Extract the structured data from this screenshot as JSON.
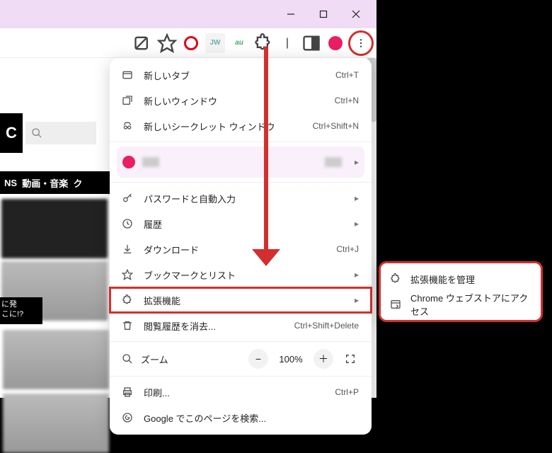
{
  "window": {
    "min": "−",
    "max": "□",
    "close": "×"
  },
  "nav": {
    "ns": "NS",
    "video": "動画・音楽",
    "gmore": "ク"
  },
  "caption": {
    "l1": "に発",
    "l2": "こに!?"
  },
  "menu": {
    "new_tab": {
      "label": "新しいタブ",
      "shortcut": "Ctrl+T"
    },
    "new_window": {
      "label": "新しいウィンドウ",
      "shortcut": "Ctrl+N"
    },
    "new_incognito": {
      "label": "新しいシークレット ウィンドウ",
      "shortcut": "Ctrl+Shift+N"
    },
    "passwords": {
      "label": "パスワードと自動入力"
    },
    "history": {
      "label": "履歴"
    },
    "downloads": {
      "label": "ダウンロード",
      "shortcut": "Ctrl+J"
    },
    "bookmarks": {
      "label": "ブックマークとリスト"
    },
    "extensions": {
      "label": "拡張機能"
    },
    "clear_browsing": {
      "label": "閲覧履歴を消去...",
      "shortcut": "Ctrl+Shift+Delete"
    },
    "zoom": {
      "label": "ズーム",
      "value": "100%",
      "minus": "−",
      "plus": "＋"
    },
    "print": {
      "label": "印刷...",
      "shortcut": "Ctrl+P"
    },
    "search": {
      "label": "Google でこのページを検索..."
    }
  },
  "submenu": {
    "manage": "拡張機能を管理",
    "webstore": "Chrome ウェブストアにアクセス"
  },
  "arrow": "▸"
}
